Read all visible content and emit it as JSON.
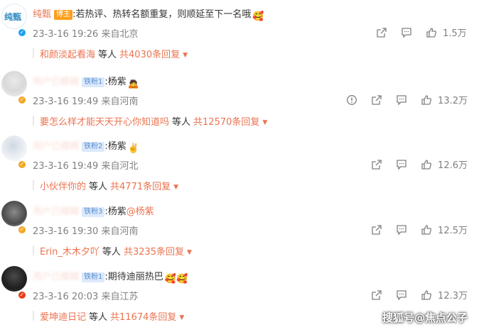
{
  "comments": [
    {
      "username": "纯甄",
      "badge": "博主",
      "avatar_text": "纯甄",
      "text": ":若热评、热转名额重复，则顺延至下一名哦",
      "emoji": "🥰",
      "mention": "",
      "meta": "23-3-16 19:26 来自北京",
      "likes": "1.5万",
      "reply_name": "和颜淡起看海",
      "reply_mid": "等人",
      "reply_count": "共4030条回复"
    },
    {
      "username": "用户已模糊",
      "badge": "铁粉1",
      "text": ":杨紫",
      "emoji": "🙇",
      "mention": "",
      "meta": "23-3-16 19:49 来自河南",
      "likes": "13.2万",
      "reply_name": "要怎么样才能天天开心你知道吗",
      "reply_mid": "等人",
      "reply_count": "共12570条回复"
    },
    {
      "username": "用户已模糊",
      "badge": "铁粉2",
      "text": ":杨紫",
      "emoji": "✌️",
      "mention": "",
      "meta": "23-3-16 19:49 来自河北",
      "likes": "12.6万",
      "reply_name": "小伙伴你的",
      "reply_mid": "等人",
      "reply_count": "共4771条回复"
    },
    {
      "username": "用户已模糊",
      "badge": "铁粉3",
      "text": ":杨紫",
      "emoji": "",
      "mention": "@杨紫",
      "meta": "23-3-16 19:30 来自河南",
      "likes": "12.5万",
      "reply_name": "Erin_木木夕吖",
      "reply_mid": "等人",
      "reply_count": "共3235条回复"
    },
    {
      "username": "用户已模糊",
      "badge": "铁粉1",
      "text": ":期待迪丽热巴",
      "emoji": "🥰🥰",
      "mention": "",
      "meta": "23-3-16 20:03 来自江苏",
      "likes": "12.3万",
      "reply_name": "爱坤迪日记",
      "reply_mid": "等人",
      "reply_count": "共11674条回复"
    }
  ],
  "watermark": "搜狐号@焦点公子",
  "colors": {
    "accent": "#eb7350",
    "meta": "#808080",
    "text": "#333333"
  }
}
